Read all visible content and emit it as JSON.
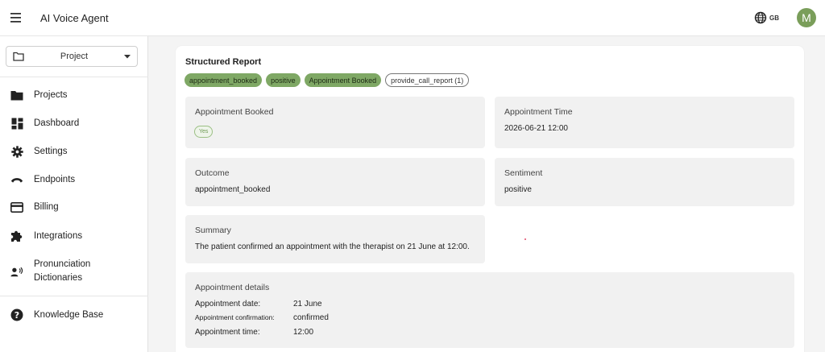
{
  "header": {
    "title": "AI Voice Agent",
    "language": "GB",
    "avatar_initial": "M"
  },
  "sidebar": {
    "project_selector": "Project",
    "items": [
      {
        "label": "Projects",
        "icon": "folder-icon"
      },
      {
        "label": "Dashboard",
        "icon": "dashboard-icon"
      },
      {
        "label": "Settings",
        "icon": "gear-icon"
      },
      {
        "label": "Endpoints",
        "icon": "phone-icon"
      },
      {
        "label": "Billing",
        "icon": "credit-card-icon"
      },
      {
        "label": "Integrations",
        "icon": "puzzle-icon"
      },
      {
        "label": "Pronunciation Dictionaries",
        "icon": "speaker-icon"
      },
      {
        "label": "Knowledge Base",
        "icon": "help-icon"
      }
    ]
  },
  "report": {
    "title": "Structured Report",
    "tags": [
      "appointment_booked",
      "positive",
      "Appointment Booked",
      "provide_call_report (1)"
    ],
    "fields": {
      "appointment_booked": {
        "label": "Appointment Booked",
        "value": "Yes"
      },
      "appointment_time": {
        "label": "Appointment Time",
        "value": "2026-06-21 12:00"
      },
      "outcome": {
        "label": "Outcome",
        "value": "appointment_booked"
      },
      "sentiment": {
        "label": "Sentiment",
        "value": "positive"
      },
      "summary": {
        "label": "Summary",
        "value": "The patient confirmed an appointment with the therapist on 21 June at 12:00."
      }
    },
    "details": {
      "label": "Appointment details",
      "rows": [
        {
          "key": "Appointment date:",
          "value": "21 June"
        },
        {
          "key": "Appointment confirmation:",
          "value": "confirmed"
        },
        {
          "key": "Appointment time:",
          "value": "12:00"
        }
      ]
    }
  },
  "colors": {
    "accent_green": "#7fa865",
    "avatar": "#7a9e5a"
  }
}
